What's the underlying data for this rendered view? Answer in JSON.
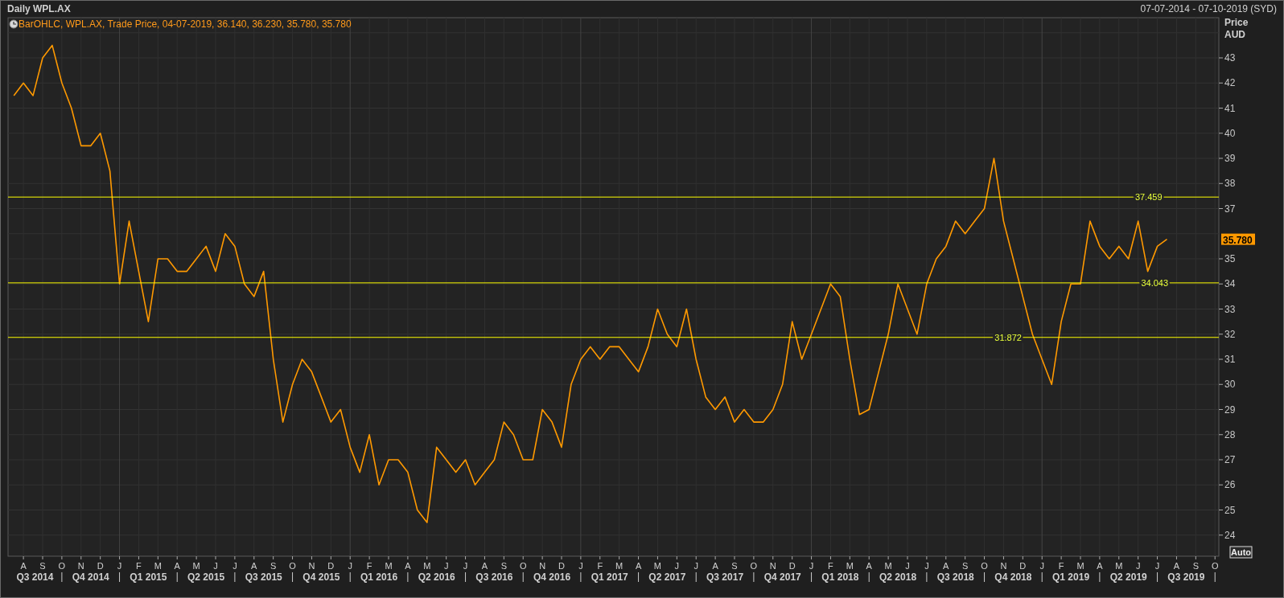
{
  "title": "Daily WPL.AX",
  "date_range": "07-07-2014 - 07-10-2019 (SYD)",
  "legend": "BarOHLC, WPL.AX, Trade Price, 04-07-2019, 36.140, 36.230, 35.780, 35.780",
  "axis_title": {
    "line_1": "Price",
    "line_2": "AUD"
  },
  "last_price": "35.780",
  "auto_button": "Auto",
  "quarters": [
    "Q3 2014",
    "Q4 2014",
    "Q1 2015",
    "Q2 2015",
    "Q3 2015",
    "Q4 2015",
    "Q1 2016",
    "Q2 2016",
    "Q3 2016",
    "Q4 2016",
    "Q1 2017",
    "Q2 2017",
    "Q3 2017",
    "Q4 2017",
    "Q1 2018",
    "Q2 2018",
    "Q3 2018",
    "Q4 2018",
    "Q1 2019",
    "Q2 2019",
    "Q3 2019"
  ],
  "chart_data": {
    "type": "line",
    "grid": true,
    "ylim": [
      23.16,
      44.6
    ],
    "categories": [
      null,
      "A",
      null,
      "S",
      null,
      "O",
      null,
      "N",
      null,
      "D",
      null,
      "J",
      null,
      "F",
      null,
      "M",
      null,
      "A",
      null,
      "M",
      null,
      "J",
      null,
      "J",
      null,
      "A",
      null,
      "S",
      null,
      "O",
      null,
      "N",
      null,
      "D",
      null,
      "J",
      null,
      "F",
      null,
      "M",
      null,
      "A",
      null,
      "M",
      null,
      "J",
      null,
      "J",
      null,
      "A",
      null,
      "S",
      null,
      "O",
      null,
      "N",
      null,
      "D",
      null,
      "J",
      null,
      "F",
      null,
      "M",
      null,
      "A",
      null,
      "M",
      null,
      "J",
      null,
      "J",
      null,
      "A",
      null,
      "S",
      null,
      "O",
      null,
      "N",
      null,
      "D",
      null,
      "J",
      null,
      "F",
      null,
      "M",
      null,
      "A",
      null,
      "M",
      null,
      "J",
      null,
      "J",
      null,
      "A",
      null,
      "S",
      null,
      "O",
      null,
      "N",
      null,
      "D",
      null,
      "J",
      null,
      "F",
      null,
      "M",
      null,
      "A",
      null,
      "M",
      null,
      "J",
      null,
      "J",
      null,
      "A",
      null,
      "S",
      null,
      "O"
    ],
    "series": [
      {
        "color": "#ff9900",
        "values": [
          41.5,
          42.0,
          41.5,
          43.0,
          43.5,
          42.0,
          41.0,
          39.5,
          39.5,
          40.0,
          38.5,
          34.0,
          36.5,
          34.5,
          32.5,
          35.0,
          35.0,
          34.5,
          34.5,
          35.0,
          35.5,
          34.5,
          36.0,
          35.5,
          34.0,
          33.5,
          34.5,
          31.0,
          28.5,
          30.0,
          31.0,
          30.5,
          29.5,
          28.5,
          29.0,
          27.5,
          26.5,
          28.0,
          26.0,
          27.0,
          27.0,
          26.5,
          25.0,
          24.5,
          27.5,
          27.0,
          26.5,
          27.0,
          26.0,
          26.5,
          27.0,
          28.5,
          28.0,
          27.0,
          27.0,
          29.0,
          28.5,
          27.5,
          30.0,
          31.0,
          31.5,
          31.0,
          31.5,
          31.5,
          31.0,
          30.5,
          31.5,
          33.0,
          32.0,
          31.5,
          33.0,
          31.0,
          29.5,
          29.0,
          29.5,
          28.5,
          29.0,
          28.5,
          28.5,
          29.0,
          30.0,
          32.5,
          31.0,
          32.0,
          33.0,
          34.0,
          33.5,
          31.0,
          28.8,
          29.0,
          30.5,
          32.0,
          34.0,
          33.0,
          32.0,
          34.0,
          35.0,
          35.5,
          36.5,
          36.0,
          36.5,
          37.0,
          39.0,
          36.5,
          35.0,
          33.5,
          32.0,
          31.0,
          30.0,
          32.5,
          34.0,
          34.0,
          36.5,
          35.5,
          35.0,
          35.5,
          35.0,
          36.5,
          34.5,
          35.5,
          35.78,
          null,
          null,
          null,
          null,
          null
        ]
      }
    ],
    "yticks": [
      24,
      25,
      26,
      27,
      28,
      29,
      30,
      31,
      32,
      33,
      34,
      35,
      37,
      38,
      39,
      40,
      41,
      42,
      43
    ],
    "ref_lines": [
      {
        "axis": "y",
        "value": 37.459,
        "label": "37.459"
      },
      {
        "axis": "y",
        "value": 34.043,
        "label": "34.043"
      },
      {
        "axis": "y",
        "value": 31.872,
        "label": "31.872"
      }
    ]
  }
}
